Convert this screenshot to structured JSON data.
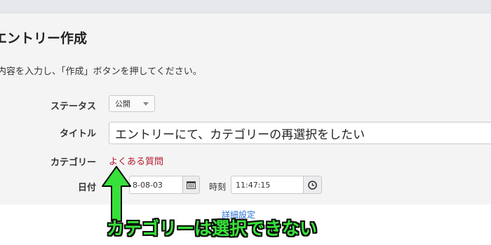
{
  "page": {
    "title": "エントリー作成",
    "instruction": "内容を入力し、「作成」ボタンを押してください。"
  },
  "form": {
    "status_label": "ステータス",
    "status_value": "公開",
    "title_label": "タイトル",
    "title_value": "エントリーにて、カテゴリーの再選択をしたい",
    "category_label": "カテゴリー",
    "category_value": "よくある質問",
    "date_label": "日付",
    "date_value": "8-08-03",
    "time_label": "時刻",
    "time_value": "11:47:15",
    "details_link": "詳細設定"
  },
  "annotation": {
    "text": "カテゴリーは選択できない"
  },
  "icons": {
    "calendar": "calendar-icon",
    "clock": "clock-icon",
    "caret": "chevron-down-icon"
  },
  "colors": {
    "category_text": "#b3192c",
    "annotation_text": "#38e03a",
    "link": "#2a6fd6"
  }
}
